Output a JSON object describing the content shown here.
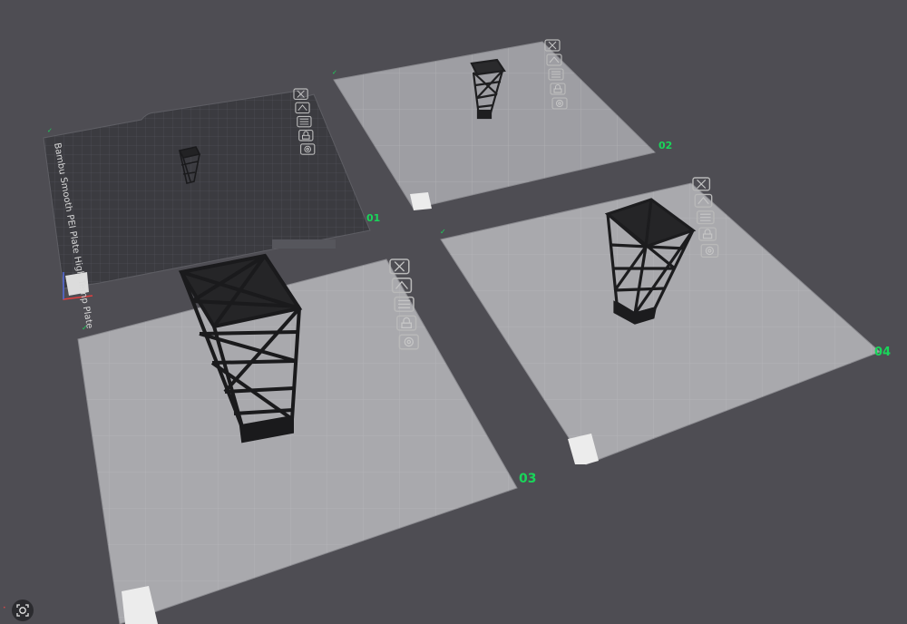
{
  "plates": [
    {
      "id": "plate-01",
      "label": "01",
      "active": true,
      "plate_type": "Bambu Smooth PEI Plate High Temp Plate"
    },
    {
      "id": "plate-02",
      "label": "02",
      "active": false
    },
    {
      "id": "plate-03",
      "label": "03",
      "active": false
    },
    {
      "id": "plate-04",
      "label": "04",
      "active": false
    }
  ],
  "plate_tools": [
    "delete-plate-icon",
    "arrange-icon",
    "orient-icon",
    "lock-icon",
    "settings-icon"
  ],
  "colors": {
    "background": "#4e4d53",
    "plate_light": "#a9a9ad",
    "plate_dark": "#3b3b40",
    "label_green": "#19d65a",
    "model": "#1e1e20"
  },
  "camera_button": {
    "icon": "camera-view-icon"
  }
}
